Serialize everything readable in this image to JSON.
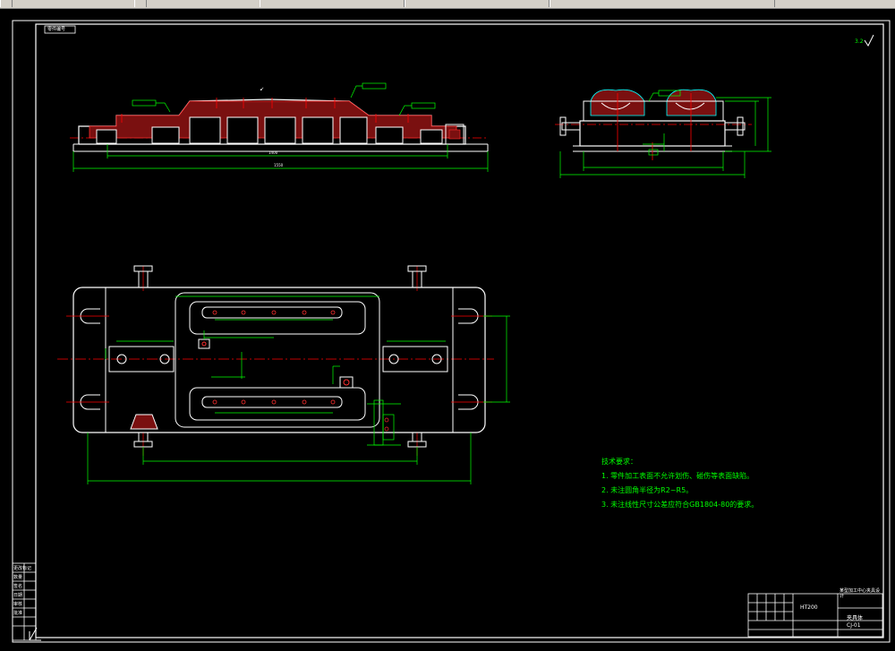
{
  "colors": {
    "background": "#000000",
    "outline": "#ffffff",
    "dimension": "#00ff00",
    "centerline": "#ff0000",
    "hatch": "#ff0000",
    "label_box": "#00ff00",
    "toolbar": "#d4d0c8"
  },
  "header_tag": "零件编号",
  "roughness_mark": "3.2",
  "notes": {
    "title": "技术要求：",
    "items": [
      "1. 零件加工表面不允许划伤、碰伤等表面缺陷。",
      "2. 未注圆角半径为R2~R5。",
      "3. 未注线性尺寸公差应符合GB1804-80的要求。"
    ]
  },
  "title_block": {
    "material": "HT200",
    "drawing_title": "某型加工中心夹具设计",
    "part_name": "夹具体",
    "drawing_no": "CJ-01"
  },
  "left_side_block": {
    "labels": [
      "更改标记",
      "数量",
      "签名",
      "日期",
      "审核",
      "批准"
    ]
  },
  "icons": [
    "roughness-check-icon",
    "origin-ucs-icon"
  ]
}
